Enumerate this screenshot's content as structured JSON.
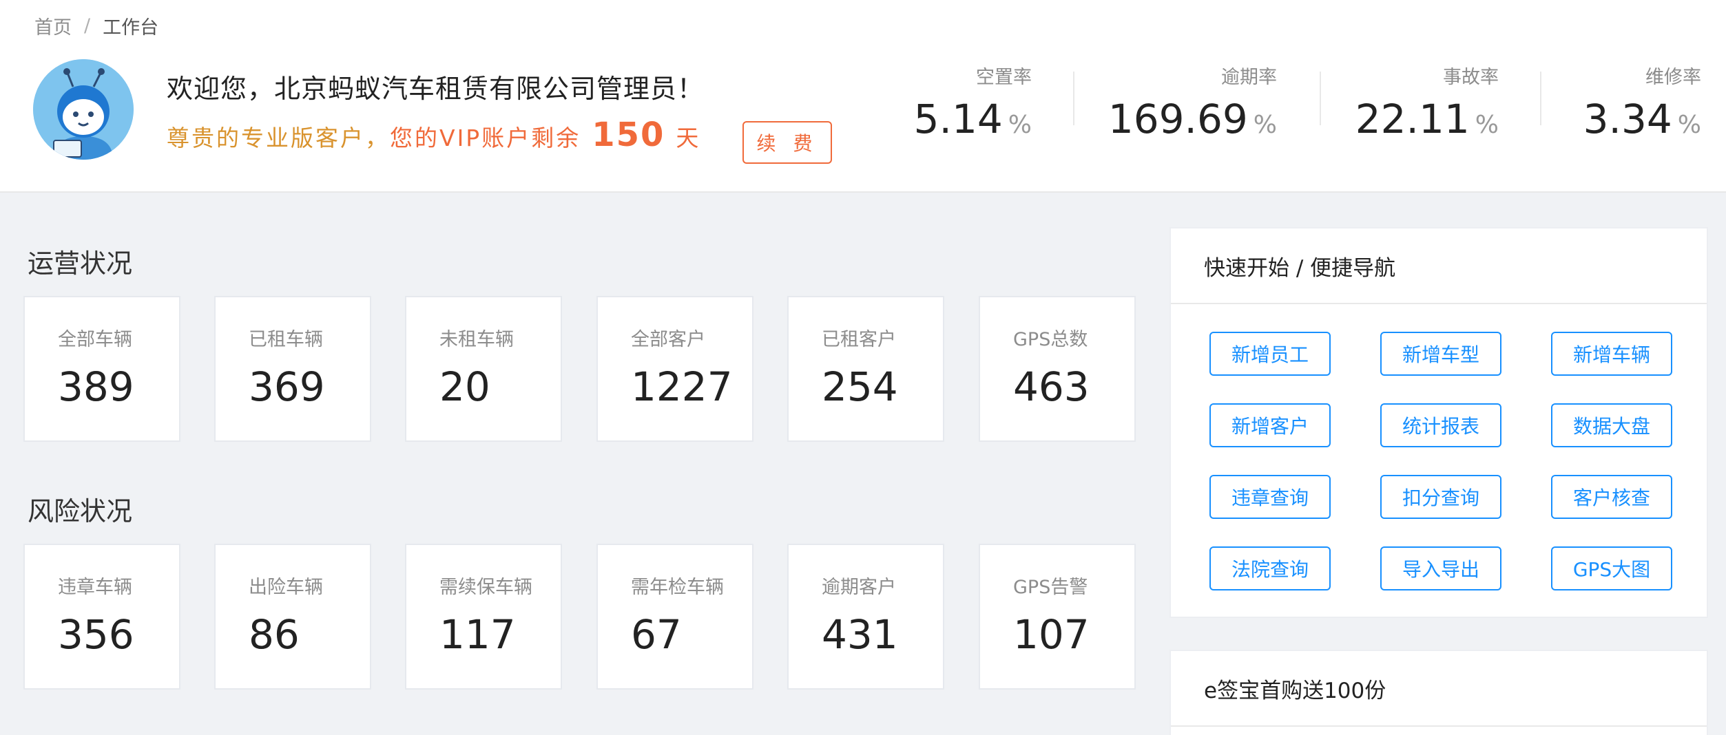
{
  "breadcrumb": {
    "home": "首页",
    "separator": "/",
    "current": "工作台"
  },
  "welcome": {
    "title": "欢迎您，北京蚂蚁汽车租赁有限公司管理员！",
    "vip_part1": "尊贵的专业版客户，",
    "vip_part2": "您的VIP账户剩余",
    "days": "150",
    "days_unit": "天",
    "renew_label": "续 费"
  },
  "rates": [
    {
      "label": "空置率",
      "value": "5.14",
      "unit": "%"
    },
    {
      "label": "逾期率",
      "value": "169.69",
      "unit": "%"
    },
    {
      "label": "事故率",
      "value": "22.11",
      "unit": "%"
    },
    {
      "label": "维修率",
      "value": "3.34",
      "unit": "%"
    }
  ],
  "operations": {
    "title": "运营状况",
    "cards": [
      {
        "label": "全部车辆",
        "value": "389"
      },
      {
        "label": "已租车辆",
        "value": "369"
      },
      {
        "label": "未租车辆",
        "value": "20"
      },
      {
        "label": "全部客户",
        "value": "1227"
      },
      {
        "label": "已租客户",
        "value": "254"
      },
      {
        "label": "GPS总数",
        "value": "463"
      }
    ]
  },
  "risk": {
    "title": "风险状况",
    "cards": [
      {
        "label": "违章车辆",
        "value": "356"
      },
      {
        "label": "出险车辆",
        "value": "86"
      },
      {
        "label": "需续保车辆",
        "value": "117"
      },
      {
        "label": "需年检车辆",
        "value": "67"
      },
      {
        "label": "逾期客户",
        "value": "431"
      },
      {
        "label": "GPS告警",
        "value": "107"
      }
    ]
  },
  "quick_nav": {
    "title": "快速开始 / 便捷导航",
    "buttons": [
      "新增员工",
      "新增车型",
      "新增车辆",
      "新增客户",
      "统计报表",
      "数据大盘",
      "违章查询",
      "扣分查询",
      "客户核查",
      "法院查询",
      "导入导出",
      "GPS大图"
    ]
  },
  "promo": {
    "title": "e签宝首购送100份"
  },
  "colors": {
    "primary": "#1890ff",
    "vip_orange": "#f06a3a",
    "vip_gold": "#d9932e"
  },
  "icons": {
    "avatar": "ant-mascot-avatar"
  }
}
